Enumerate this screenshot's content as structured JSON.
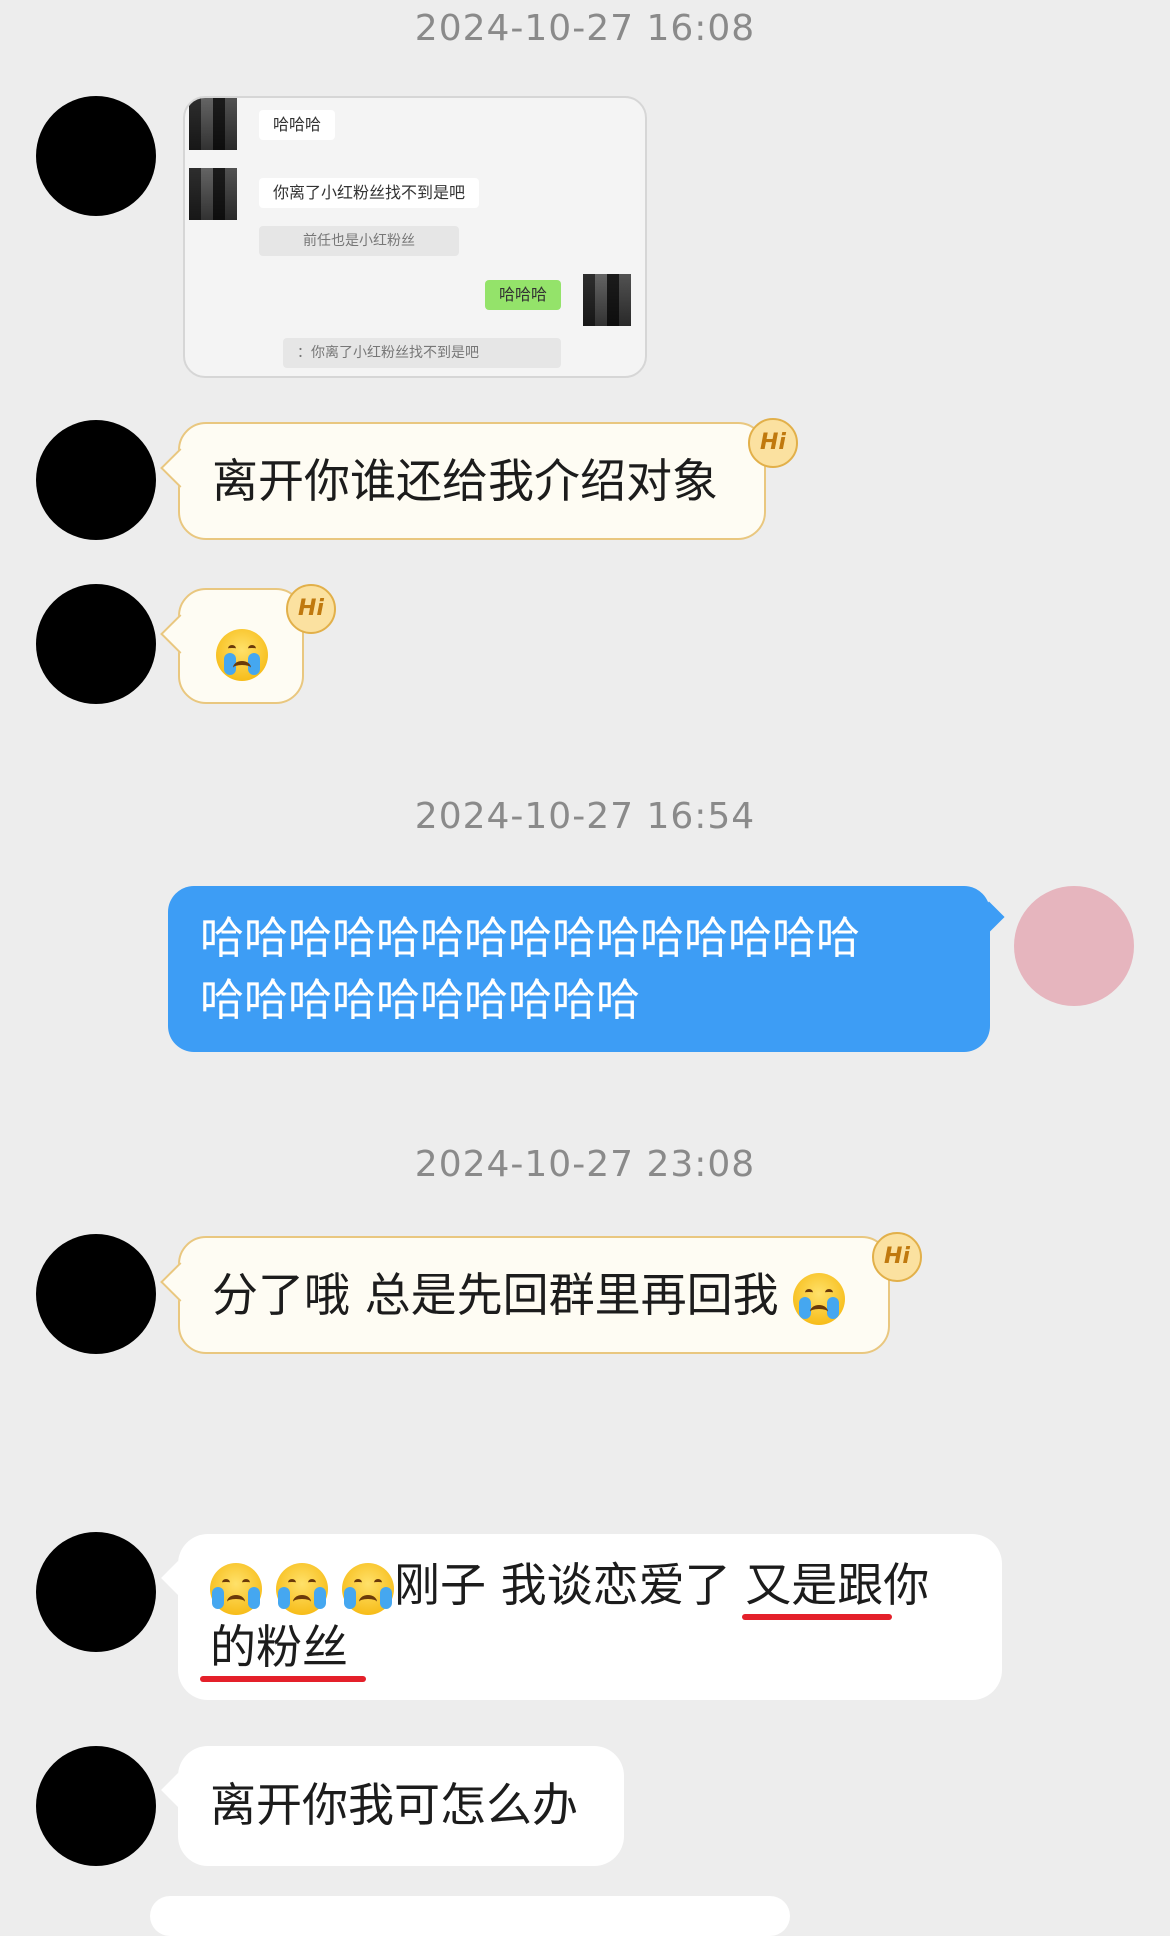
{
  "timestamps": [
    "2024-10-27 16:08",
    "2024-10-27 16:54",
    "2024-10-27 23:08"
  ],
  "screenshot": {
    "msg1": "哈哈哈",
    "msg2": "你离了小红粉丝找不到是吧",
    "quote1": "前任也是小红粉丝",
    "msg3": "哈哈哈",
    "quote2": "：你离了小红粉丝找不到是吧"
  },
  "messages": {
    "m1": "离开你谁还给我介绍对象",
    "m3_line1": "哈哈哈哈哈哈哈哈哈哈哈哈哈哈哈",
    "m3_line2": "哈哈哈哈哈哈哈哈哈哈",
    "m4": "分了哦 总是先回群里再回我",
    "m5_a": "刚子 我谈恋爱了 ",
    "m5_b": "又是跟你",
    "m5_c": "的粉丝",
    "m6": "离开你我可怎么办"
  },
  "badges": {
    "hi": "Hi"
  },
  "icons": {
    "cry": "crying-face-icon",
    "sob": "sob-face-icon",
    "badge": "hi-badge-icon"
  },
  "colors": {
    "bg": "#ededed",
    "outgoing": "#3d9df5",
    "incoming_tan": "#fefcf3",
    "underline": "#e4202a"
  }
}
